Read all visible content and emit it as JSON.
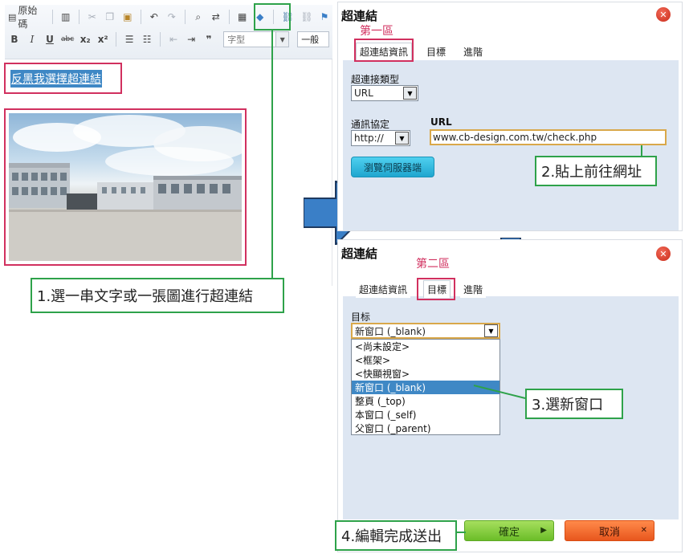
{
  "toolbar": {
    "source_label": "原始碼",
    "font_placeholder": "字型",
    "size_value": "一般",
    "row1_icons": [
      "document-icon",
      "template-icon",
      "cut-icon",
      "copy-icon",
      "paste-icon",
      "undo-icon",
      "redo-icon",
      "find-icon",
      "replace-icon",
      "select-all-icon",
      "eraser-icon",
      "link-icon",
      "unlink-icon",
      "anchor-icon"
    ],
    "row2_buttons": {
      "bold": "B",
      "italic": "I",
      "underline": "U",
      "strike": "abc",
      "subscript": "x₂",
      "superscript": "x²",
      "blockquote": "❞"
    }
  },
  "editor": {
    "selected_text": "反黑我選擇超連結",
    "photo_icon": "factory-photo"
  },
  "annotations": {
    "step1": "1.選一串文字或一張圖進行超連結",
    "step2": "2.貼上前往網址",
    "step3": "3.選新窗口",
    "step4": "4.編輯完成送出",
    "zone1": "第一區",
    "zone2": "第二區"
  },
  "dialog1": {
    "title": "超連結",
    "close_icon": "close-icon",
    "tabs": [
      "超連結資訊",
      "目標",
      "進階"
    ],
    "link_type_label": "超連接類型",
    "link_type_value": "URL",
    "protocol_label": "通訊協定",
    "protocol_value": "http://",
    "url_label": "URL",
    "url_value": "www.cb-design.com.tw/check.php",
    "browse_button": "瀏覽伺服器端"
  },
  "dialog2": {
    "title": "超連結",
    "close_icon": "close-icon",
    "tabs": [
      "超連結資訊",
      "目標",
      "進階"
    ],
    "target_label": "目标",
    "target_value": "新窗口 (_blank)",
    "options": [
      "<尚未設定>",
      "<框架>",
      "<快顯視窗>",
      "新窗口 (_blank)",
      "整頁 (_top)",
      "本窗口 (_self)",
      "父窗口 (_parent)"
    ],
    "selected_index": 3,
    "ok_button": "確定",
    "cancel_button": "取消"
  },
  "colors": {
    "annotation_green": "#2ea24a",
    "annotation_red": "#d1305f",
    "arrow_blue": "#3a7fc7",
    "selection_blue": "#3f88c5",
    "dialog_body": "#dde6f2",
    "ok_green": "#7cc936",
    "cancel_orange": "#f06a2e"
  }
}
